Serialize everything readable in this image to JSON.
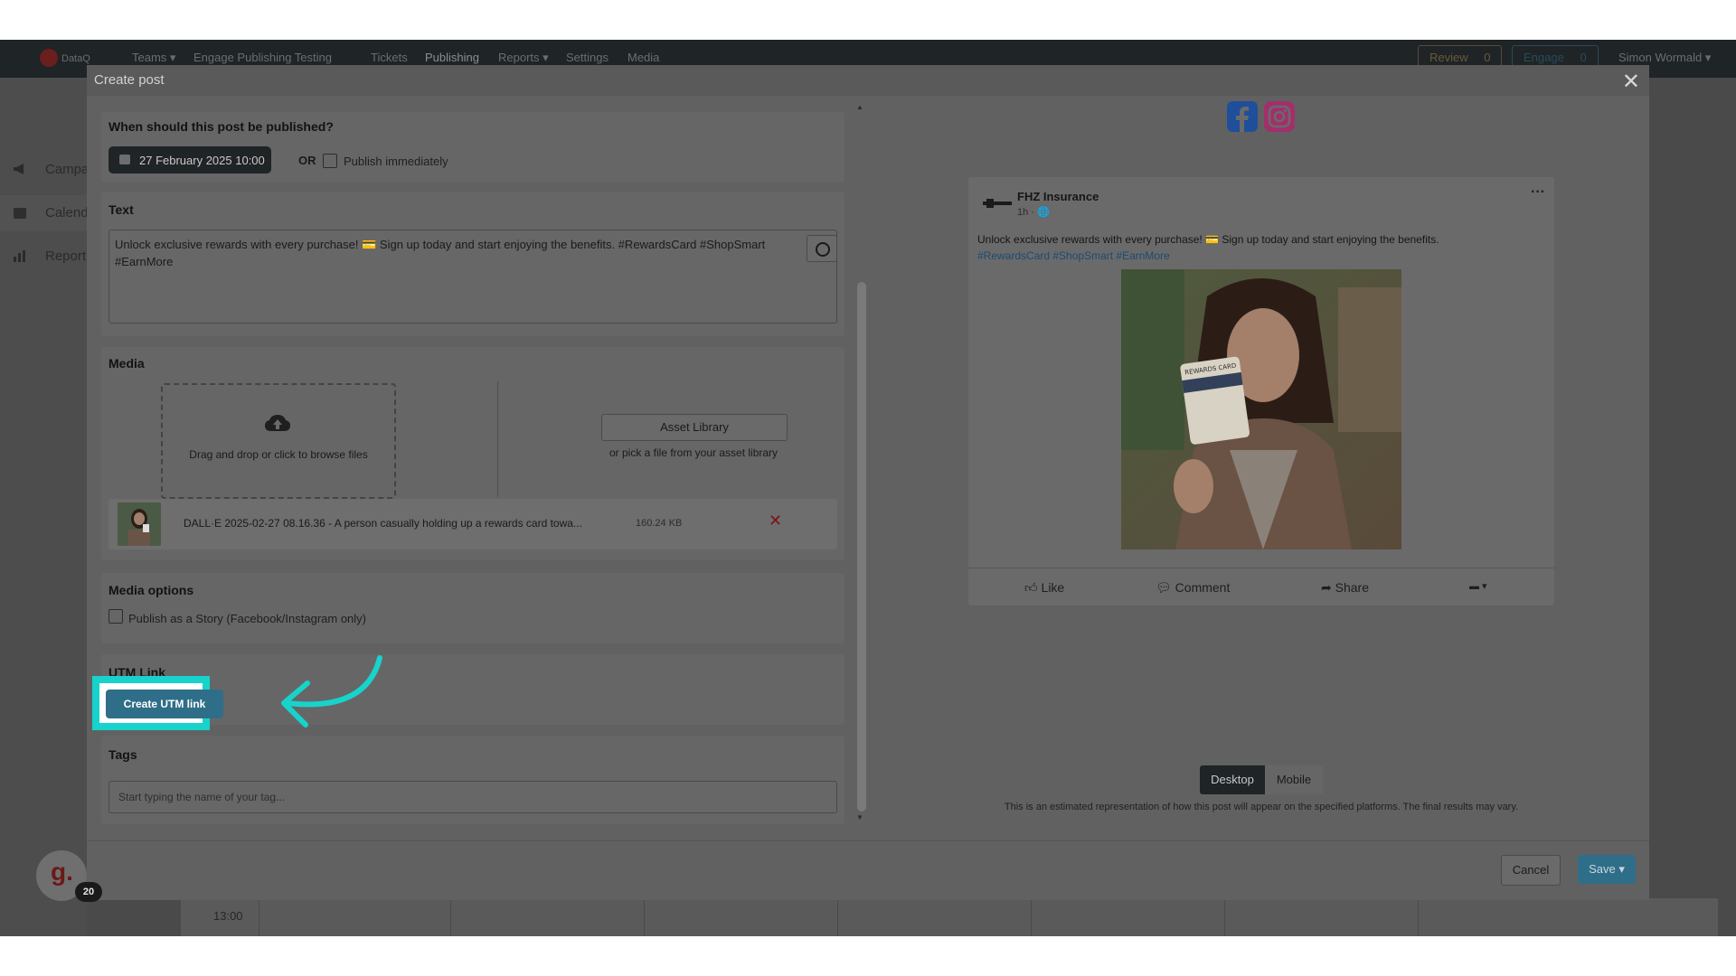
{
  "nav": {
    "brand": "DataQ",
    "links": [
      "Teams ▾",
      "Engage Publishing Testing",
      "Tickets",
      "Publishing",
      "Reports ▾",
      "Settings",
      "Media"
    ],
    "review_label": "Review",
    "review_count": "0",
    "engage_label": "Engage",
    "engage_count": "0",
    "user": "Simon Wormald ▾"
  },
  "sidebar": {
    "items": [
      {
        "label": "Campa",
        "icon": "megaphone-icon"
      },
      {
        "label": "Calend",
        "icon": "calendar-icon"
      },
      {
        "label": "Report",
        "icon": "bar-chart-icon"
      }
    ]
  },
  "calendar": {
    "time": "13:00"
  },
  "modal": {
    "title": "Create post",
    "schedule": {
      "title": "When should this post be published?",
      "date": "27 February 2025 10:00",
      "or": "OR",
      "publish_immediately": "Publish immediately"
    },
    "text": {
      "title": "Text",
      "value": "Unlock exclusive rewards with every purchase! 💳 Sign up today and start enjoying the benefits. #RewardsCard #ShopSmart #EarnMore"
    },
    "media": {
      "title": "Media",
      "dropzone_text": "Drag and drop or click to browse files",
      "asset_library_label": "Asset Library",
      "asset_library_sub": "or pick a file from your asset library",
      "file_name": "DALL·E 2025-02-27 08.16.36 - A person casually holding up a rewards card towa...",
      "file_size": "160.24 KB"
    },
    "media_options": {
      "title": "Media options",
      "story_label": "Publish as a Story (Facebook/Instagram only)"
    },
    "utm": {
      "title": "UTM Link",
      "button_label": "Create UTM link"
    },
    "tags": {
      "title": "Tags",
      "placeholder": "Start typing the name of your tag..."
    },
    "preview": {
      "page_name": "FHZ Insurance",
      "time": "1h · 🌐",
      "text_main": "Unlock exclusive rewards with every purchase! 💳 Sign up today and start enjoying the benefits.",
      "hashtags": "#RewardsCard #ShopSmart #EarnMore",
      "card_text": "REWARDS CARD",
      "like": "Like",
      "comment": "Comment",
      "share": "Share",
      "desktop": "Desktop",
      "mobile": "Mobile",
      "disclaimer": "This is an estimated representation of how this post will appear on the specified platforms. The final results may vary."
    },
    "footer": {
      "cancel": "Cancel",
      "save": "Save ▾"
    }
  },
  "chat": {
    "letter": "g.",
    "badge": "20"
  },
  "colors": {
    "highlight": "#17d3cb",
    "primary_button": "#2f6e88",
    "facebook": "#1877f2",
    "instagram": "#c13584"
  }
}
